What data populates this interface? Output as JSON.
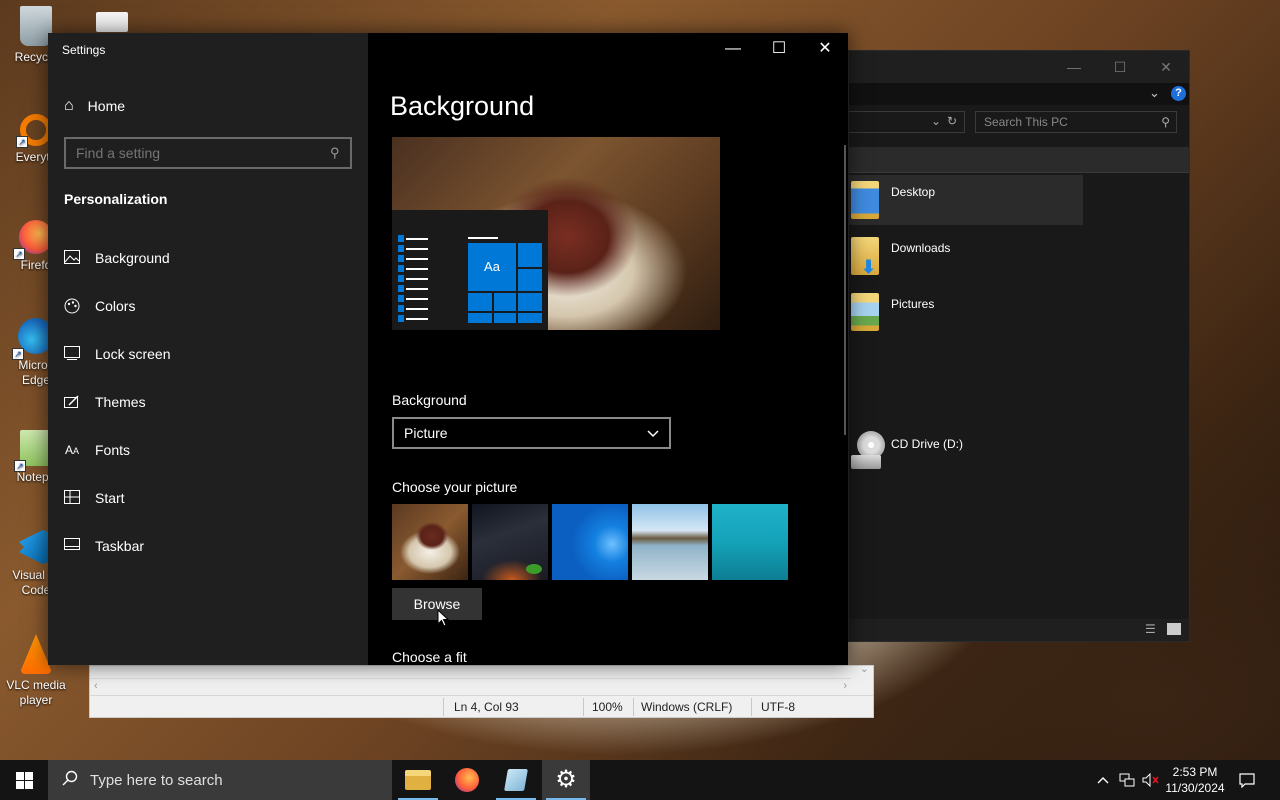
{
  "desktop": {
    "icons": [
      {
        "label": "Recycle",
        "icon": "recycle-bin-icon"
      },
      {
        "label": "Everyth",
        "icon": "everything-icon"
      },
      {
        "label": "Firefo",
        "icon": "firefox-icon"
      },
      {
        "label": "Micros\nEdge",
        "icon": "edge-icon"
      },
      {
        "label": "Notepa",
        "icon": "notepad-icon"
      },
      {
        "label": "Visual St\nCode",
        "icon": "vscode-icon"
      },
      {
        "label": "VLC media\nplayer",
        "icon": "vlc-icon"
      }
    ]
  },
  "explorer": {
    "search_placeholder": "Search This PC",
    "items": [
      "Desktop",
      "Downloads",
      "Pictures",
      "CD Drive (D:)"
    ]
  },
  "notepad": {
    "status": {
      "position": "Ln 4, Col 93",
      "zoom": "100%",
      "line_ending": "Windows (CRLF)",
      "encoding": "UTF-8"
    }
  },
  "settings": {
    "window_title": "Settings",
    "home_label": "Home",
    "search_placeholder": "Find a setting",
    "section": "Personalization",
    "nav_items": [
      {
        "label": "Background",
        "icon": "picture-icon"
      },
      {
        "label": "Colors",
        "icon": "palette-icon"
      },
      {
        "label": "Lock screen",
        "icon": "lock-screen-icon"
      },
      {
        "label": "Themes",
        "icon": "brush-icon"
      },
      {
        "label": "Fonts",
        "icon": "font-icon"
      },
      {
        "label": "Start",
        "icon": "start-icon"
      },
      {
        "label": "Taskbar",
        "icon": "taskbar-icon"
      }
    ],
    "page_title": "Background",
    "preview_tile_text": "Aa",
    "background_label": "Background",
    "background_value": "Picture",
    "choose_picture_label": "Choose your picture",
    "browse_label": "Browse",
    "choose_fit_label": "Choose a fit"
  },
  "taskbar": {
    "search_placeholder": "Type here to search",
    "time": "2:53 PM",
    "date": "11/30/2024",
    "apps": [
      "file-explorer-icon",
      "firefox-icon",
      "notepad-icon",
      "settings-icon"
    ]
  },
  "colors": {
    "accent": "#0078d7",
    "settings_nav_bg": "#1f1f1f",
    "settings_content_bg": "#000000",
    "taskbar_bg": "#141414"
  }
}
